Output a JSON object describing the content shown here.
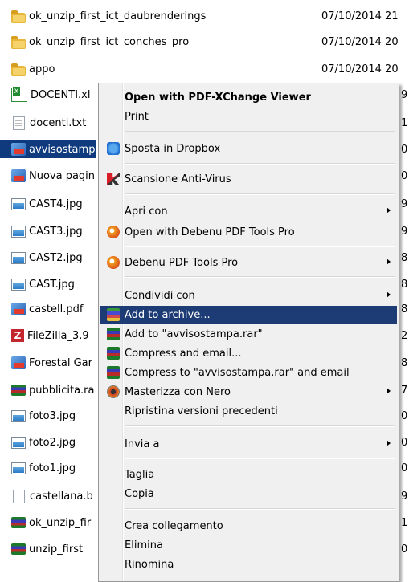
{
  "files": [
    {
      "name": "ok_unzip_first_ict_daubrenderings",
      "date": "07/10/2014 21",
      "icon": "folder-icon",
      "selected": false
    },
    {
      "name": "ok_unzip_first_ict_conches_pro",
      "date": "07/10/2014 20",
      "icon": "folder-icon",
      "selected": false
    },
    {
      "name": "appo",
      "date": "07/10/2014 20",
      "icon": "folder-icon",
      "selected": false
    },
    {
      "name": "DOCENTI.xl",
      "edge": "9",
      "icon": "excel-file-icon",
      "selected": false
    },
    {
      "name": "docenti.txt",
      "edge": "1",
      "icon": "text-file-icon",
      "selected": false
    },
    {
      "name": "avvisostamp",
      "edge": "0",
      "icon": "pdf-file-icon",
      "selected": true
    },
    {
      "name": "Nuova pagin",
      "edge": "0",
      "icon": "pdf-file-icon",
      "selected": false
    },
    {
      "name": "CAST4.jpg",
      "edge": "9",
      "icon": "image-file-icon",
      "selected": false
    },
    {
      "name": "CAST3.jpg",
      "edge": "9",
      "icon": "image-file-icon",
      "selected": false
    },
    {
      "name": "CAST2.jpg",
      "edge": "8",
      "icon": "image-file-icon",
      "selected": false
    },
    {
      "name": "CAST.jpg",
      "edge": "8",
      "icon": "image-file-icon",
      "selected": false
    },
    {
      "name": "castell.pdf",
      "edge": "8",
      "icon": "pdf-file-icon",
      "selected": false
    },
    {
      "name": "FileZilla_3.9",
      "edge": "2",
      "icon": "filezilla-icon",
      "selected": false
    },
    {
      "name": "Forestal Gar",
      "edge": "8",
      "icon": "pdf-file-icon",
      "selected": false
    },
    {
      "name": "pubblicita.ra",
      "edge": "7",
      "icon": "rar-file-icon",
      "selected": false
    },
    {
      "name": "foto3.jpg",
      "edge": "0",
      "icon": "image-file-icon",
      "selected": false
    },
    {
      "name": "foto2.jpg",
      "edge": "0",
      "icon": "image-file-icon",
      "selected": false
    },
    {
      "name": "foto1.jpg",
      "edge": "0",
      "icon": "image-file-icon",
      "selected": false
    },
    {
      "name": "castellana.b",
      "edge": "9",
      "icon": "blank-file-icon",
      "selected": false
    },
    {
      "name": "ok_unzip_fir",
      "edge": "1",
      "icon": "rar-file-icon",
      "selected": false
    },
    {
      "name": "unzip_first",
      "edge": "0",
      "icon": "rar-file-icon",
      "selected": false
    }
  ],
  "context_menu": {
    "items": [
      {
        "label": "Open with PDF-XChange Viewer",
        "bold": true
      },
      {
        "label": "Print"
      },
      {
        "label": "Sposta in Dropbox",
        "icon": "dropbox-icon"
      },
      {
        "label": "Scansione Anti-Virus",
        "icon": "kaspersky-icon"
      },
      {
        "label": "Apri con",
        "submenu": true
      },
      {
        "label": "Open with Debenu PDF Tools Pro",
        "icon": "debenu-icon"
      },
      {
        "label": "Debenu PDF Tools Pro",
        "icon": "debenu-icon",
        "submenu": true
      },
      {
        "label": "Condividi con",
        "submenu": true
      },
      {
        "label": "Add to archive...",
        "icon": "winrar-icon",
        "highlighted": true
      },
      {
        "label": "Add to \"avvisostampa.rar\"",
        "icon": "winrar-icon"
      },
      {
        "label": "Compress and email...",
        "icon": "winrar-icon"
      },
      {
        "label": "Compress to \"avvisostampa.rar\" and email",
        "icon": "winrar-icon"
      },
      {
        "label": "Masterizza con Nero",
        "icon": "nero-icon",
        "submenu": true
      },
      {
        "label": "Ripristina versioni precedenti"
      },
      {
        "label": "Invia a",
        "submenu": true
      },
      {
        "label": "Taglia"
      },
      {
        "label": "Copia"
      },
      {
        "label": "Crea collegamento"
      },
      {
        "label": "Elimina"
      },
      {
        "label": "Rinomina"
      }
    ]
  },
  "colors": {
    "selection": "#0f3a7d",
    "menu_highlight": "#1d3c75",
    "menu_background": "#f0f0f0"
  }
}
